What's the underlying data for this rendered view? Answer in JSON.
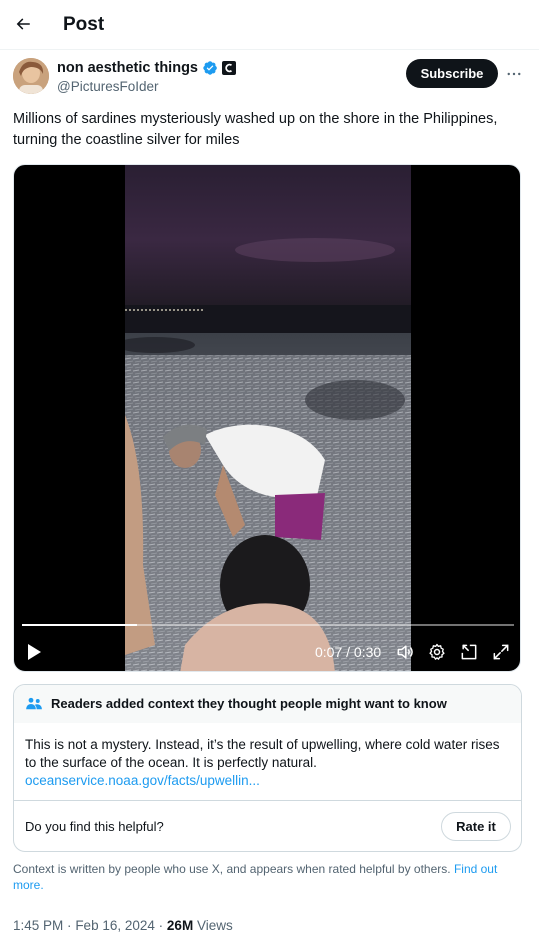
{
  "header": {
    "title": "Post",
    "back_icon": "arrow-left-icon"
  },
  "author": {
    "display_name": "non aesthetic things",
    "handle": "@PicturesFoIder",
    "verified_icon": "verified-badge-icon",
    "affiliate_icon": "affiliate-badge-icon",
    "subscribe_label": "Subscribe",
    "more_icon": "more-options-icon"
  },
  "tweet": {
    "text": "Millions of sardines mysteriously washed up on the shore in the Philippines, turning the coastline silver for miles"
  },
  "video": {
    "current_time": "0:07",
    "duration": "0:30",
    "time_display": "0:07 / 0:30",
    "progress_fraction": 0.233,
    "controls": [
      "play-icon",
      "volume-icon",
      "settings-icon",
      "pop-out-icon",
      "fullscreen-icon"
    ]
  },
  "community_note": {
    "header": "Readers added context they thought people might want to know",
    "header_icon": "people-icon",
    "body": "This is not a mystery. Instead, it’s the result of upwelling, where cold water rises to the surface of the ocean. It is perfectly natural.",
    "link": "oceanservice.noaa.gov/facts/upwellin...",
    "helpful_question": "Do you find this helpful?",
    "rate_label": "Rate it"
  },
  "disclaimer": {
    "text": "Context is written by people who use X, and appears when rated helpful by others.",
    "link": "Find out more."
  },
  "meta": {
    "time": "1:45 PM",
    "date": "Feb 16, 2024",
    "separator": "·",
    "views_count": "26M",
    "views_label": "Views"
  },
  "colors": {
    "accent": "#1d9bf0",
    "text": "#0f1419",
    "secondary_text": "#536471",
    "border": "#cfd9de",
    "button_dark": "#0f1419"
  }
}
